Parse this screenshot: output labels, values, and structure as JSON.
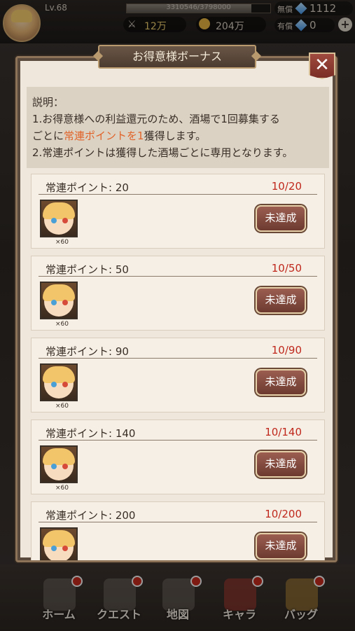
{
  "status_bar": {
    "level": "Lv.68",
    "exp": "3310546/3798000",
    "exp_fraction": 0.87,
    "stamina": "12万",
    "gold": "204万",
    "free_gems_label": "無償",
    "free_gems": "1112",
    "paid_gems_label": "有償",
    "paid_gems": "0"
  },
  "dialog": {
    "title": "お得意様ボーナス",
    "description": {
      "heading": "説明：",
      "line1_a": "1.お得意様への利益還元のため、酒場で1回募集する",
      "line1_b_pre": "ごとに",
      "line1_b_hl": "常連ポイントを1",
      "line1_b_post": "獲得します。",
      "line2": "2.常連ポイントは獲得した酒場ごとに専用となります。"
    },
    "rewards": [
      {
        "label": "常連ポイント: 20",
        "progress": "10/20",
        "qty": "×60",
        "status": "未達成"
      },
      {
        "label": "常連ポイント: 50",
        "progress": "10/50",
        "qty": "×60",
        "status": "未達成"
      },
      {
        "label": "常連ポイント: 90",
        "progress": "10/90",
        "qty": "×60",
        "status": "未達成"
      },
      {
        "label": "常連ポイント: 140",
        "progress": "10/140",
        "qty": "×60",
        "status": "未達成"
      },
      {
        "label": "常連ポイント: 200",
        "progress": "10/200",
        "qty": "",
        "status": "未達成"
      }
    ]
  },
  "nav": {
    "items": [
      {
        "label": "ホーム"
      },
      {
        "label": "クエスト"
      },
      {
        "label": "地図"
      },
      {
        "label": "キャラ"
      },
      {
        "label": "バッグ"
      }
    ]
  }
}
